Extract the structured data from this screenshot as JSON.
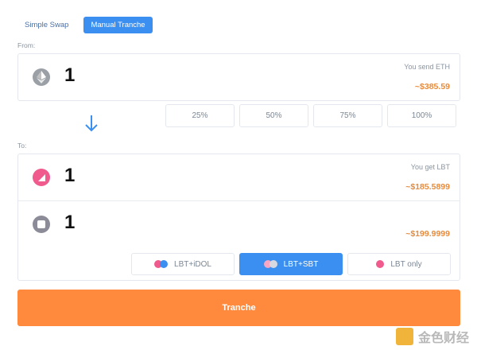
{
  "tabs": [
    {
      "label": "Simple Swap",
      "active": false
    },
    {
      "label": "Manual Tranche",
      "active": true
    }
  ],
  "from": {
    "label": "From:",
    "amount": "1",
    "send_label": "You send ETH",
    "price": "~$385.59",
    "icon": "eth-icon"
  },
  "percentages": [
    "25%",
    "50%",
    "75%",
    "100%"
  ],
  "to": {
    "label": "To:",
    "lbt": {
      "amount": "1",
      "get_label": "You get LBT",
      "price": "~$185.5899",
      "icon": "lbt-icon"
    },
    "sbt": {
      "amount": "1",
      "price": "~$199.9999",
      "icon": "sbt-icon"
    }
  },
  "options": [
    {
      "label": "LBT+iDOL",
      "active": false
    },
    {
      "label": "LBT+SBT",
      "active": true
    },
    {
      "label": "LBT only",
      "active": false
    }
  ],
  "action": {
    "label": "Tranche"
  },
  "watermark": {
    "text": "金色财经"
  },
  "colors": {
    "accent": "#3a8ff0",
    "action": "#ff8a3d",
    "price": "#e88b3a"
  }
}
